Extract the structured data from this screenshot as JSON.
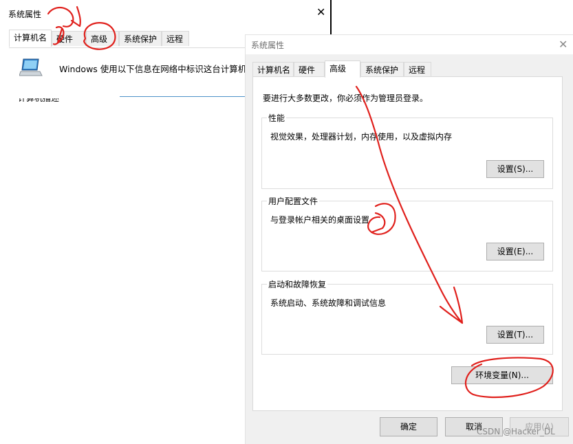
{
  "back_dialog": {
    "title": "系统属性",
    "close_glyph": "✕",
    "tabs": [
      "计算机名",
      "硬件",
      "高级",
      "系统保护",
      "远程"
    ],
    "active_tab": "计算机名",
    "description": "Windows 使用以下信息在网络中标识这台计算机。",
    "partial_label": "计算机描述"
  },
  "front_dialog": {
    "title": "系统属性",
    "close_glyph": "✕",
    "tabs": [
      "计算机名",
      "硬件",
      "高级",
      "系统保护",
      "远程"
    ],
    "active_tab": "高级",
    "admin_note": "要进行大多数更改，你必须作为管理员登录。",
    "groups": [
      {
        "title": "性能",
        "description": "视觉效果，处理器计划，内存使用，以及虚拟内存",
        "button": "设置(S)..."
      },
      {
        "title": "用户配置文件",
        "description": "与登录帐户相关的桌面设置",
        "button": "设置(E)..."
      },
      {
        "title": "启动和故障恢复",
        "description": "系统启动、系统故障和调试信息",
        "button": "设置(T)..."
      }
    ],
    "env_button": "环境变量(N)...",
    "ok_button": "确定",
    "cancel_button": "取消",
    "apply_button": "应用(A)"
  },
  "watermark": "CSDN @Hacker_DL",
  "colors": {
    "annotation": "#e0201c",
    "dialog_bg": "#f0f0f0",
    "button_bg": "#e1e1e1"
  }
}
